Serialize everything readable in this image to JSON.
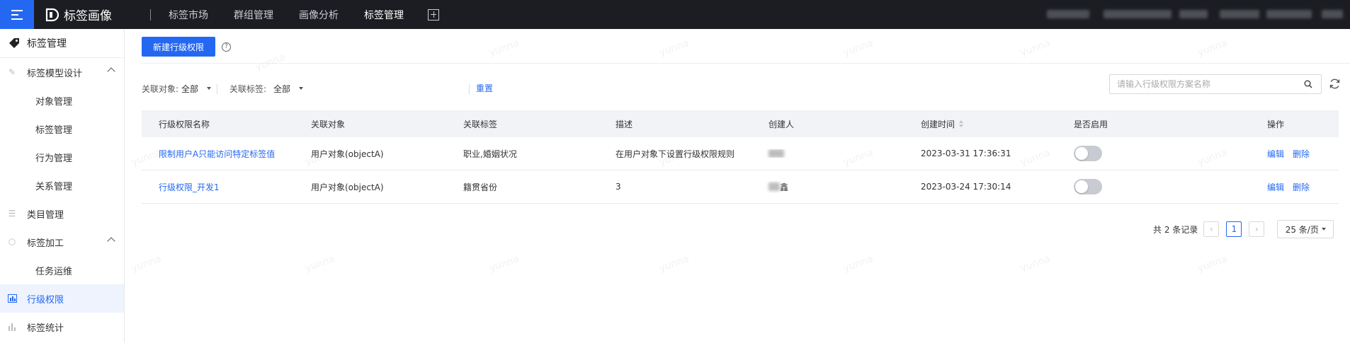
{
  "app": {
    "name": "标签画像"
  },
  "top_nav": {
    "items": [
      {
        "label": "标签市场",
        "active": false
      },
      {
        "label": "群组管理",
        "active": false
      },
      {
        "label": "画像分析",
        "active": false
      },
      {
        "label": "标签管理",
        "active": true
      }
    ]
  },
  "sidebar": {
    "header": "标签管理",
    "items": [
      {
        "label": "标签模型设计",
        "icon": "design-icon",
        "expanded": true,
        "children": [
          "对象管理",
          "标签管理",
          "行为管理",
          "关系管理"
        ]
      },
      {
        "label": "类目管理",
        "icon": "list-icon"
      },
      {
        "label": "标签加工",
        "icon": "process-icon",
        "expanded": true,
        "children": [
          "任务运维"
        ]
      },
      {
        "label": "行级权限",
        "icon": "permission-icon",
        "active": true
      },
      {
        "label": "标签统计",
        "icon": "bar-chart-icon"
      }
    ]
  },
  "toolbar": {
    "new_button": "新建行级权限",
    "help_glyph": "?"
  },
  "filters": {
    "object_label": "关联对象:",
    "object_value": "全部",
    "tag_label": "关联标签:",
    "tag_value": "全部",
    "reset": "重置"
  },
  "search": {
    "placeholder": "请输入行级权限方案名称"
  },
  "table": {
    "headers": [
      "行级权限名称",
      "关联对象",
      "关联标签",
      "描述",
      "创建人",
      "创建时间",
      "是否启用",
      "操作"
    ],
    "rows": [
      {
        "name": "限制用户A只能访问特定标签值",
        "object": "用户对象(objectA)",
        "tag": "职业,婚姻状况",
        "description": "在用户对象下设置行级权限规则",
        "creator_suffix": "",
        "created_at": "2023-03-31 17:36:31",
        "enabled": false,
        "edit": "编辑",
        "delete": "删除"
      },
      {
        "name": "行级权限_开发1",
        "object": "用户对象(objectA)",
        "tag": "籍贯省份",
        "description": "3",
        "creator_suffix": "鑫",
        "created_at": "2023-03-24 17:30:14",
        "enabled": false,
        "edit": "编辑",
        "delete": "删除"
      }
    ]
  },
  "pagination": {
    "total": "共 2 条记录",
    "current_page": "1",
    "page_size": "25 条/页"
  },
  "watermark": "yunna",
  "colors": {
    "primary": "#2468f2",
    "topbar": "#1b1d22"
  }
}
